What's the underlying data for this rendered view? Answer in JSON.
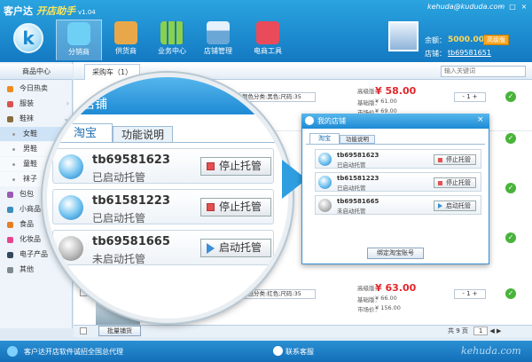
{
  "window": {
    "app_name": "客户达",
    "subtitle": "开店助手",
    "version": "v1.04",
    "minimize": "–",
    "maximize": "□",
    "close": "×"
  },
  "nav": [
    {
      "label": "分销商",
      "icon": "distributor-icon",
      "active": true
    },
    {
      "label": "供货商",
      "icon": "supplier-icon"
    },
    {
      "label": "业务中心",
      "icon": "business-center-icon"
    },
    {
      "label": "店铺管理",
      "icon": "store-management-icon"
    },
    {
      "label": "电商工具",
      "icon": "ecommerce-tools-icon"
    }
  ],
  "user": {
    "email": "kehuda@kududa.com",
    "balance_label": "余额：",
    "balance": "5000.00",
    "advanced_label": "高级版",
    "shop_label": "店铺：",
    "shop": "tb69581651"
  },
  "sidebar": {
    "header": "商品中心",
    "items": [
      {
        "label": "今日热卖",
        "color": "#f08a1c"
      },
      {
        "label": "服装",
        "color": "#d9534f",
        "chevron": "›"
      },
      {
        "label": "鞋袜",
        "color": "#8a6d3b",
        "chevron": "⌄"
      },
      {
        "label": "女鞋",
        "sub": true,
        "selected": true
      },
      {
        "label": "男鞋",
        "sub": true
      },
      {
        "label": "童鞋",
        "sub": true
      },
      {
        "label": "袜子",
        "sub": true
      },
      {
        "label": "包包",
        "color": "#9b59b6",
        "chevron": "›"
      },
      {
        "label": "小商品",
        "color": "#3c8dbc",
        "chevron": "›"
      },
      {
        "label": "食品",
        "color": "#e67e22"
      },
      {
        "label": "化妆品",
        "color": "#e84393"
      },
      {
        "label": "电子产品",
        "color": "#34495e",
        "chevron": "›"
      },
      {
        "label": "其他",
        "color": "#7f8c8d",
        "chevron": "›"
      }
    ]
  },
  "main": {
    "cart_tab": "采购车（1）",
    "search_placeholder": "输入关键词",
    "products": [
      {
        "option": "颜色分类:黑色;尺码:35",
        "price_label": "高级版：",
        "price": "¥ 58.00",
        "basic_label": "基础版：",
        "basic": "¥ 61.00",
        "market_label": "市场价：",
        "market": "¥ 69.00",
        "qty": "1"
      },
      {
        "option": "颜色分类:红色;尺码:35",
        "price_label": "高级版：",
        "price": "¥ 63.00",
        "basic_label": "基础版：",
        "basic": "¥ 66.00",
        "market_label": "市场价：",
        "market": "¥ 156.00",
        "qty": "1"
      }
    ],
    "batch_button": "批量铺货",
    "pager": "共 9 页",
    "page_box": "1",
    "cart_icon": "cart-icon",
    "qty_minus": "-",
    "qty_plus": "+",
    "tag": "包邮"
  },
  "magnifier": {
    "title": "店铺",
    "tabs": [
      "淘宝",
      "功能说明"
    ],
    "accounts": [
      {
        "name": "tb69581623",
        "status": "已启动托管",
        "button": "停止托管",
        "active": true
      },
      {
        "name": "tb61581223",
        "status": "已启动托管",
        "button": "停止托管",
        "active": true
      },
      {
        "name": "tb69581665",
        "status": "未启动托管",
        "button": "启动托管",
        "active": false
      }
    ]
  },
  "dialog": {
    "title": "我的店铺",
    "close": "×",
    "tabs": [
      "淘宝",
      "功能说明"
    ],
    "accounts": [
      {
        "name": "tb69581623",
        "status": "已启动托管",
        "button": "停止托管",
        "active": true
      },
      {
        "name": "tb61581223",
        "status": "已启动托管",
        "button": "停止托管",
        "active": true
      },
      {
        "name": "tb69581665",
        "status": "未启动托管",
        "button": "启动托管",
        "active": false
      }
    ],
    "bind_button": "绑定淘宝账号"
  },
  "statusbar": {
    "text": "客户达开店软件诚招全国总代理",
    "contact": "联系客服",
    "watermark": "kehuda.com"
  },
  "colors": {
    "accent": "#1e8ad4",
    "price": "#e3262a",
    "header": "#1479c2"
  }
}
